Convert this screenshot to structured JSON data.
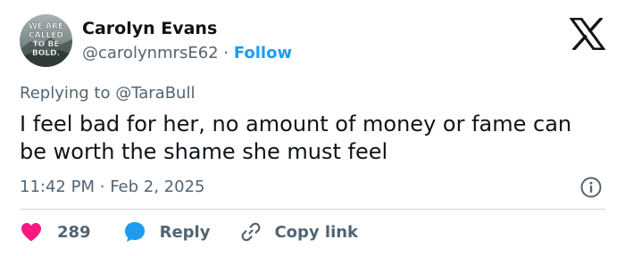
{
  "author": {
    "display_name": "Carolyn Evans",
    "handle": "@carolynmrsE62",
    "separator": "·",
    "follow_label": "Follow",
    "avatar_text": [
      "WE ARE",
      "CALLED",
      "TO BE",
      "BOLD."
    ]
  },
  "reply_context": {
    "prefix": "Replying to",
    "mention": "@TaraBull"
  },
  "tweet": {
    "text": "I feel bad for her, no amount of money or fame can be worth the shame she must feel",
    "time": "11:42 PM",
    "separator": "·",
    "date": "Feb 2, 2025"
  },
  "actions": {
    "like_count": "289",
    "reply_label": "Reply",
    "copy_label": "Copy link"
  },
  "colors": {
    "link_blue": "#1d9bf0",
    "like_pink": "#f91880",
    "secondary_text": "#536471",
    "primary_text": "#0f1419",
    "divider": "#cfd9de"
  },
  "icons": [
    "x-logo-icon",
    "info-icon",
    "heart-icon",
    "speech-bubble-icon",
    "link-icon"
  ]
}
